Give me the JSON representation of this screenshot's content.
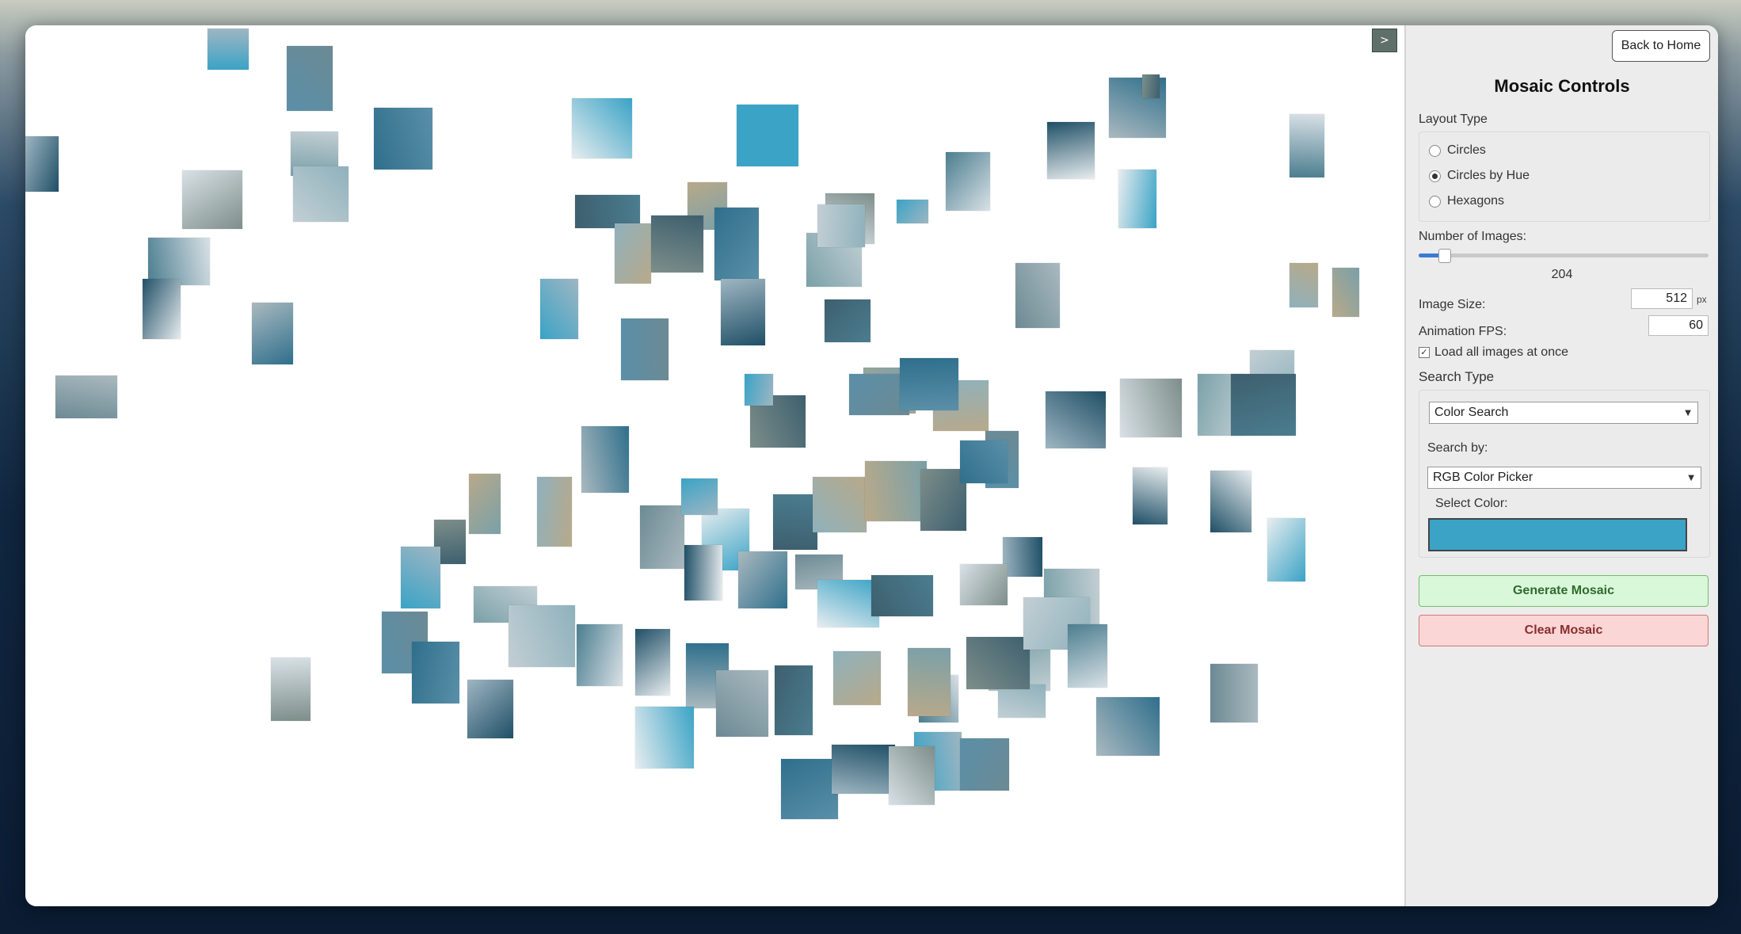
{
  "panel": {
    "back_button": "Back to Home",
    "title": "Mosaic Controls",
    "layout_type_label": "Layout Type",
    "layout_options": [
      "Circles",
      "Circles by Hue",
      "Hexagons"
    ],
    "layout_selected": "Circles by Hue",
    "num_images_label": "Number of Images:",
    "num_images_value": "204",
    "num_images_fraction": 0.08,
    "image_size_label": "Image Size:",
    "image_size_value": "512",
    "image_size_unit": "px",
    "fps_label": "Animation FPS:",
    "fps_value": "60",
    "load_all_label": "Load all images at once",
    "load_all_checked": true,
    "search_type_label": "Search Type",
    "search_type_value": "Color Search",
    "search_by_label": "Search by:",
    "search_by_value": "RGB Color Picker",
    "select_color_label": "Select Color:",
    "selected_color": "#3aa3c6",
    "generate_button": "Generate Mosaic",
    "clear_button": "Clear Mosaic"
  },
  "canvas": {
    "toggle_label": ">"
  },
  "colors": {
    "generate_bg": "#d9f7d9",
    "clear_bg": "#fbd6d6",
    "accent": "#3aa3c6"
  }
}
